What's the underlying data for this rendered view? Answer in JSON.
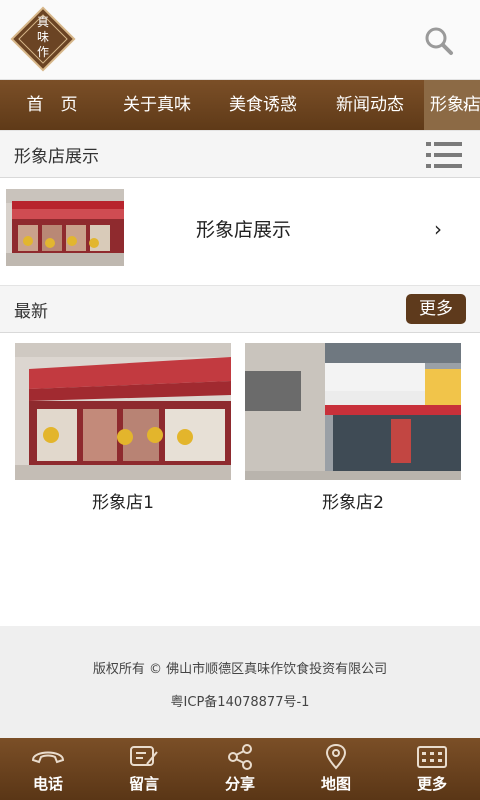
{
  "header": {
    "logo_text": [
      "真",
      "味",
      "作"
    ]
  },
  "nav": {
    "items": [
      {
        "label": "首　页"
      },
      {
        "label": "关于真味"
      },
      {
        "label": "美食诱惑"
      },
      {
        "label": "新闻动态"
      },
      {
        "label": "形象店"
      }
    ],
    "active_index": 4,
    "more_icon": "chevron-right-icon"
  },
  "section": {
    "title": "形象店展示",
    "menu_icon": "list-icon"
  },
  "feature": {
    "label": "形象店展示",
    "chevron": "›"
  },
  "latest": {
    "title": "最新",
    "more_label": "更多"
  },
  "cards": [
    {
      "label": "形象店1"
    },
    {
      "label": "形象店2"
    }
  ],
  "footer": {
    "copyright": "版权所有 © 佛山市顺德区真味作饮食投资有限公司",
    "icp": "粤ICP备14078877号-1"
  },
  "tabbar": {
    "items": [
      {
        "label": "电话",
        "icon": "phone-icon"
      },
      {
        "label": "留言",
        "icon": "message-icon"
      },
      {
        "label": "分享",
        "icon": "share-icon"
      },
      {
        "label": "地图",
        "icon": "map-pin-icon"
      },
      {
        "label": "更多",
        "icon": "grid-icon"
      }
    ]
  },
  "colors": {
    "brand": "#6a4320",
    "nav_active": "#8c6a45",
    "footer_bg": "#efefef"
  }
}
